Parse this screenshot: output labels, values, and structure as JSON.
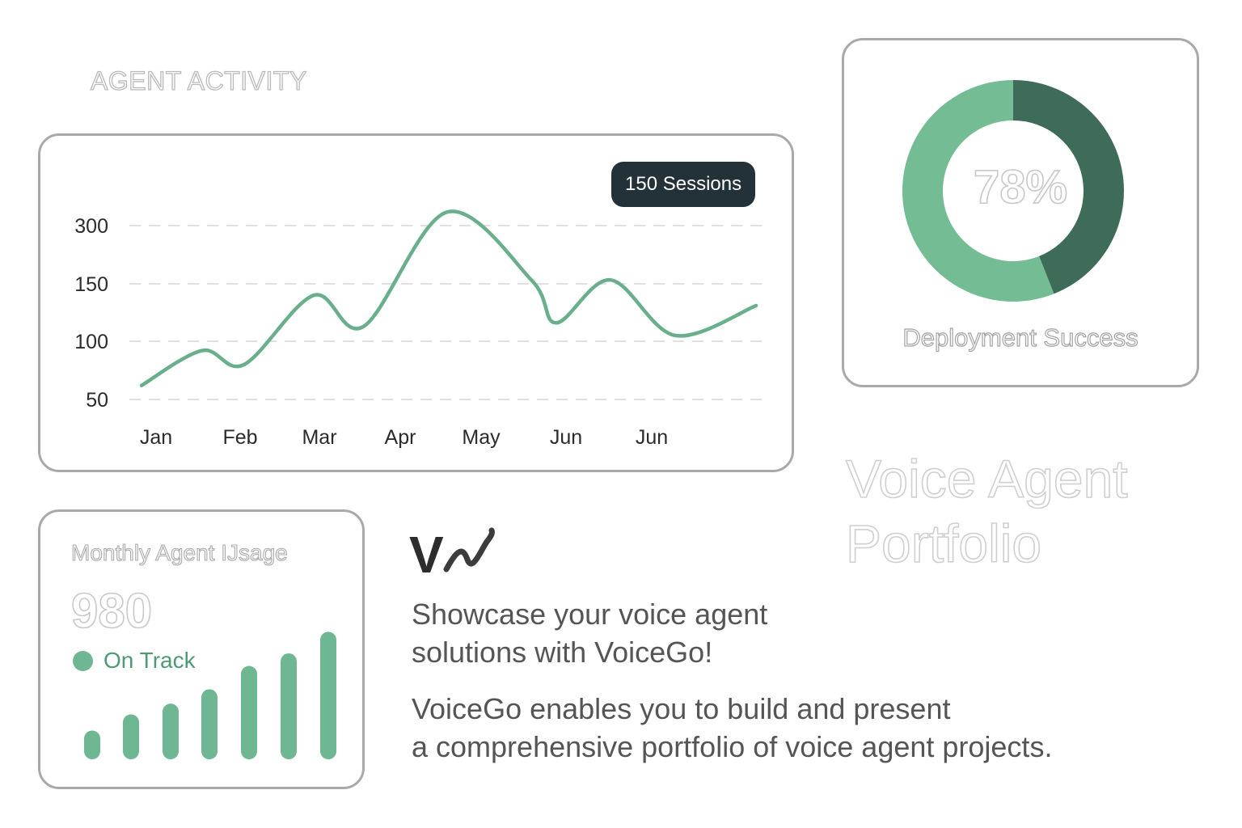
{
  "header": {
    "section_title": "AGENT ACTIVITY"
  },
  "activity": {
    "badge": "150 Sessions",
    "chart_data": {
      "type": "line",
      "title": "",
      "y_ticks": [
        "300",
        "150",
        "100",
        "50"
      ],
      "x_ticks": [
        "Jan",
        "Feb",
        "Mar",
        "Apr",
        "May",
        "Jun",
        "Jun"
      ],
      "series": [
        {
          "values": [
            62,
            92,
            80,
            140,
            113,
            335,
            158,
            116,
            160,
            105,
            131
          ]
        }
      ],
      "grid": true,
      "color": "#6aaf8b"
    }
  },
  "deployment": {
    "percent_label": "78%",
    "label": "Deployment Success",
    "chart_data": {
      "type": "pie",
      "slices": [
        {
          "value": 44,
          "color": "#3f6b59"
        },
        {
          "value": 56,
          "color": "#73bc94"
        }
      ]
    }
  },
  "hero": {
    "title_line1": "Voice Agent",
    "title_line2": "Portfolio"
  },
  "usage": {
    "title": "Monthly Agent IJsage",
    "value": "980",
    "status": "On Track",
    "status_color": "#6fb792",
    "chart_data": {
      "type": "bar",
      "values": [
        1.6,
        2.5,
        3.1,
        3.9,
        5.2,
        5.9,
        7.1
      ],
      "color": "#6fb792"
    }
  },
  "brand": {
    "logo_text": "V",
    "tagline_line1": "Showcase your voice agent",
    "tagline_line2": "solutions with VoiceGo!",
    "desc_line1": "VoiceGo enables you to build and present",
    "desc_line2": "a comprehensive portfolio of voice agent projects."
  }
}
